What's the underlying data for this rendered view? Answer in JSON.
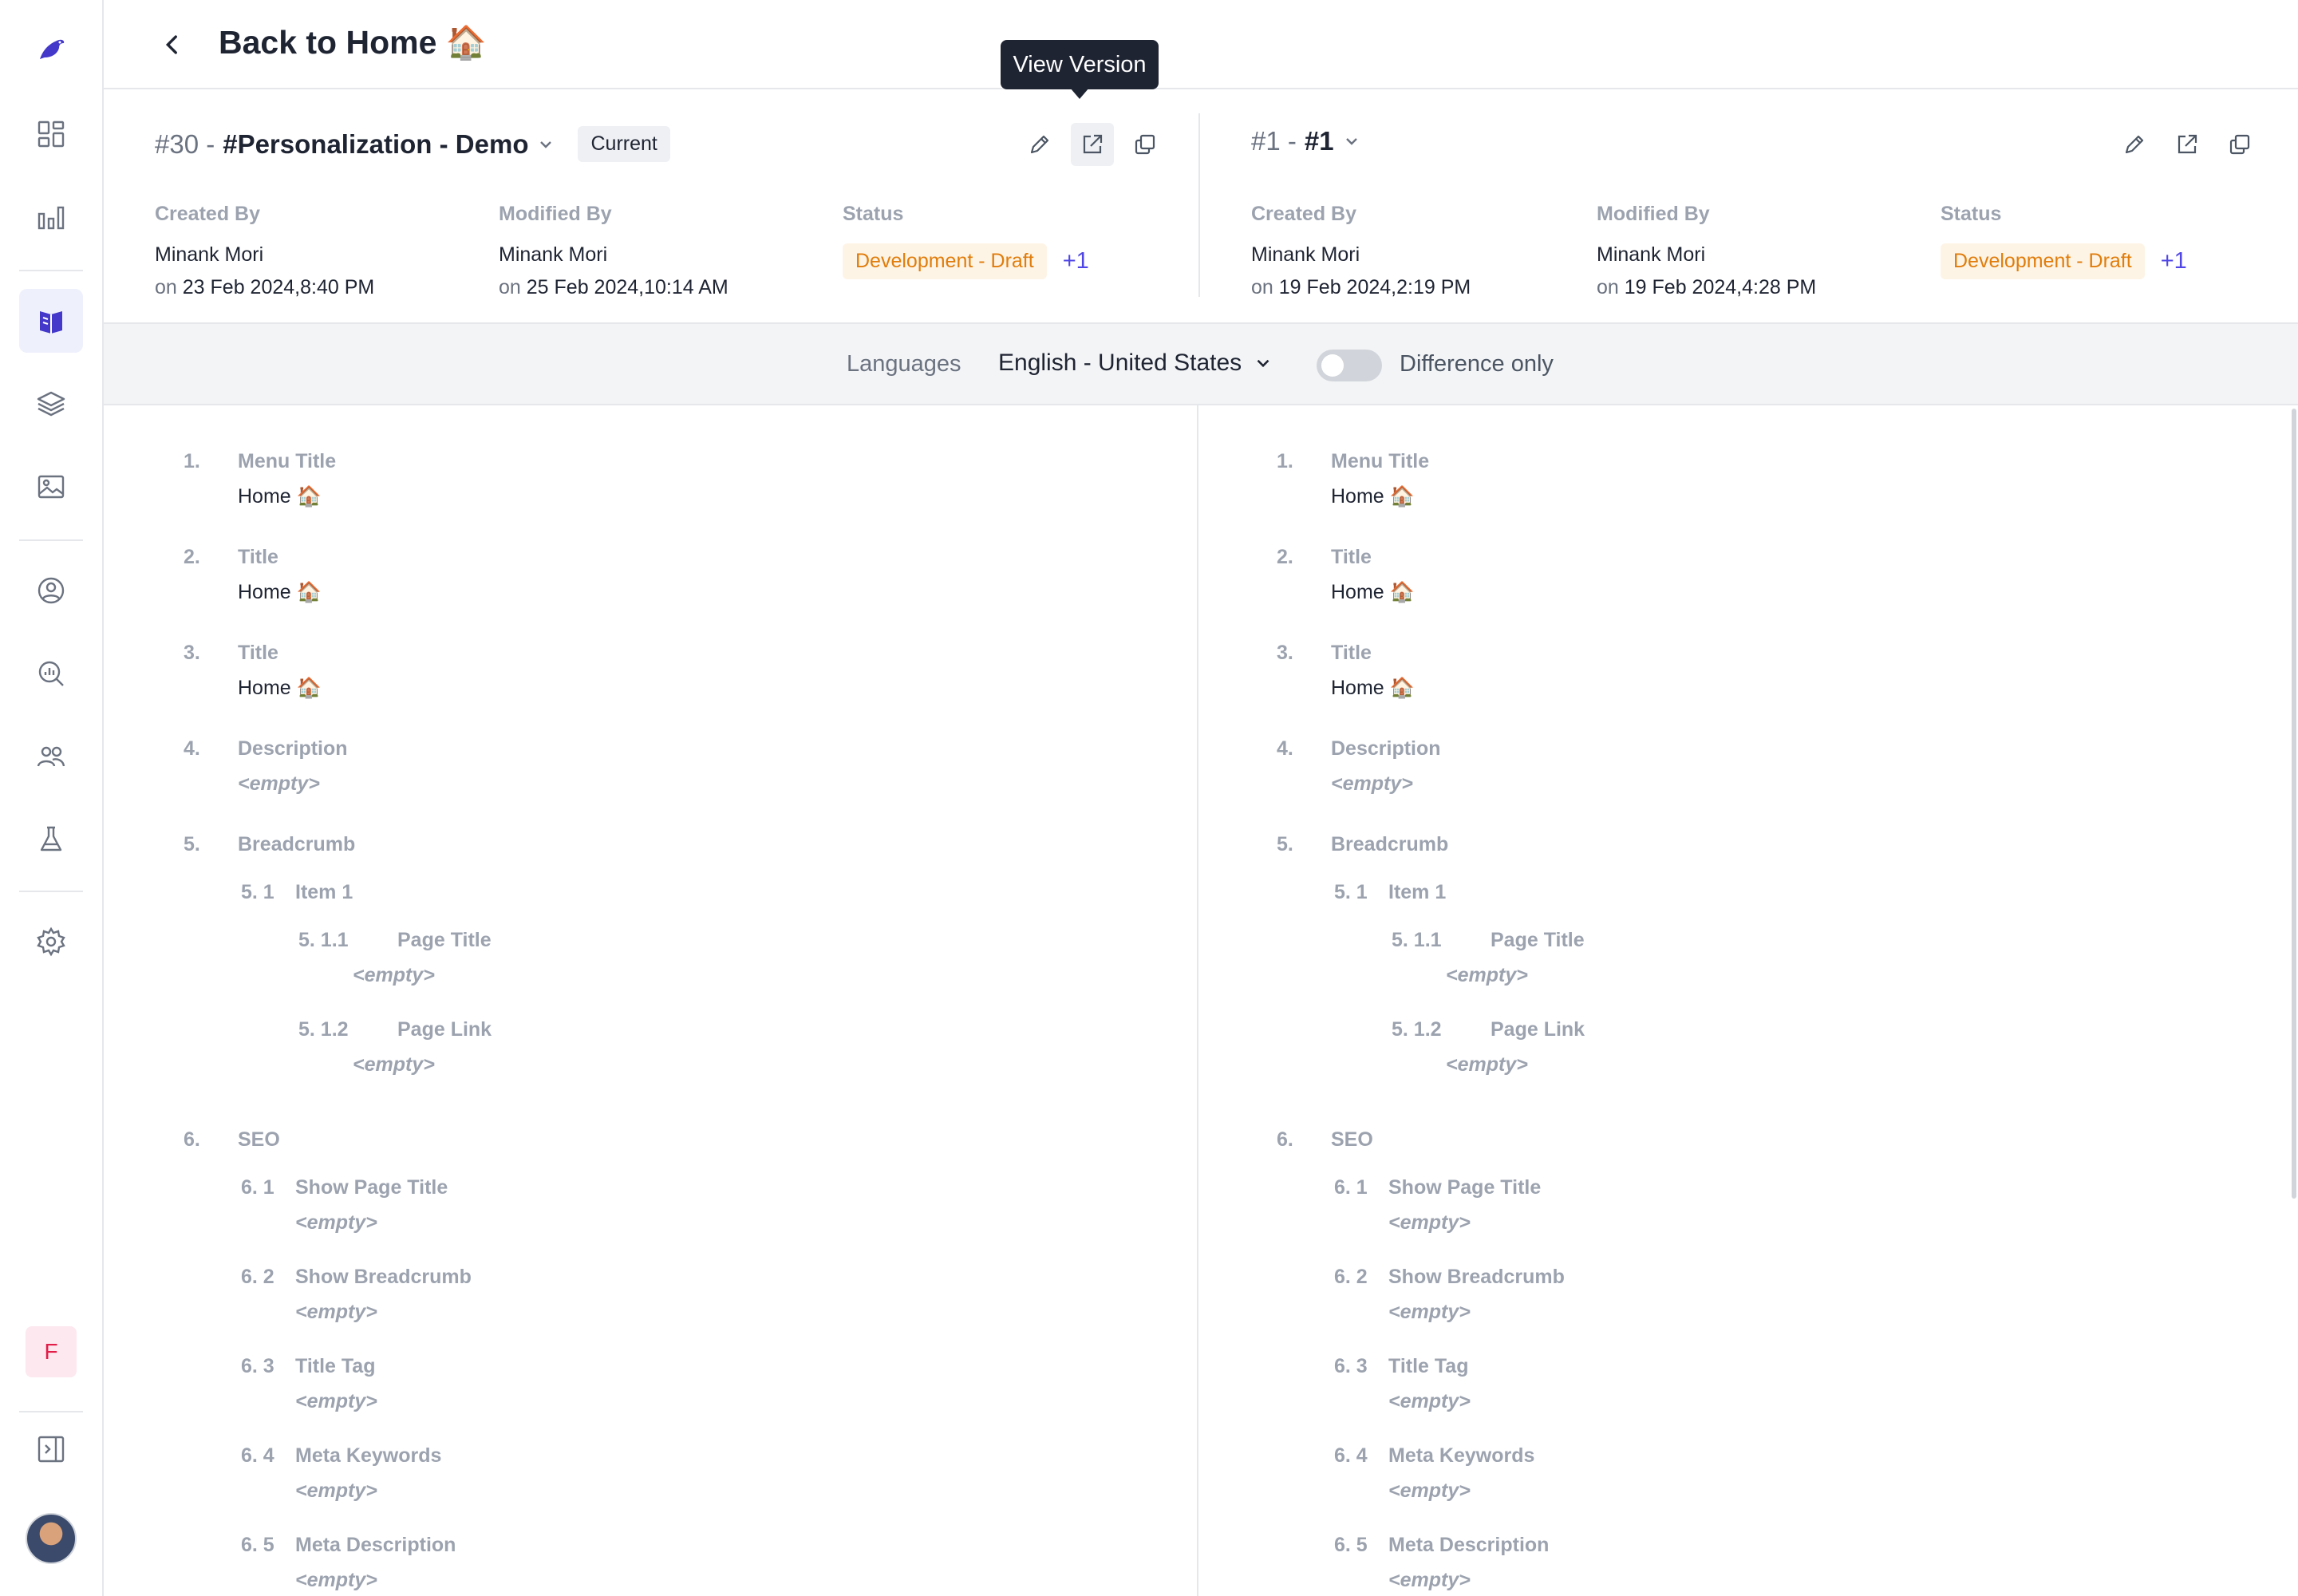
{
  "tooltip": "View Version",
  "header": {
    "back_title": "Back to Home 🏠"
  },
  "left_version": {
    "number": "#30 -",
    "name": "#Personalization - Demo",
    "badge": "Current",
    "created_label": "Created By",
    "created_name": "Minank Mori",
    "created_on_prefix": "on",
    "created_on": "23 Feb 2024,8:40 PM",
    "modified_label": "Modified By",
    "modified_name": "Minank Mori",
    "modified_on_prefix": "on",
    "modified_on": "25 Feb 2024,10:14 AM",
    "status_label": "Status",
    "status": "Development - Draft",
    "status_extra": "+1"
  },
  "right_version": {
    "number": "#1 -",
    "name": "#1",
    "created_label": "Created By",
    "created_name": "Minank Mori",
    "created_on_prefix": "on",
    "created_on": "19 Feb 2024,2:19 PM",
    "modified_label": "Modified By",
    "modified_name": "Minank Mori",
    "modified_on_prefix": "on",
    "modified_on": "19 Feb 2024,4:28 PM",
    "status_label": "Status",
    "status": "Development - Draft",
    "status_extra": "+1"
  },
  "langbar": {
    "label": "Languages",
    "selected": "English - United States",
    "diff_label": "Difference only",
    "diff_on": false
  },
  "fields": [
    {
      "num": "1.",
      "label": "Menu Title",
      "value": "Home 🏠"
    },
    {
      "num": "2.",
      "label": "Title",
      "value": "Home 🏠"
    },
    {
      "num": "3.",
      "label": "Title",
      "value": "Home 🏠"
    },
    {
      "num": "4.",
      "label": "Description",
      "value": "<empty>"
    },
    {
      "num": "5.",
      "label": "Breadcrumb"
    },
    {
      "num": "5. 1",
      "label": "Item 1"
    },
    {
      "num": "5. 1.1",
      "label": "Page Title",
      "value": "<empty>"
    },
    {
      "num": "5. 1.2",
      "label": "Page Link",
      "value": "<empty>"
    },
    {
      "num": "6.",
      "label": "SEO"
    },
    {
      "num": "6. 1",
      "label": "Show Page Title",
      "value": "<empty>"
    },
    {
      "num": "6. 2",
      "label": "Show Breadcrumb",
      "value": "<empty>"
    },
    {
      "num": "6. 3",
      "label": "Title Tag",
      "value": "<empty>"
    },
    {
      "num": "6. 4",
      "label": "Meta Keywords",
      "value": "<empty>"
    },
    {
      "num": "6. 5",
      "label": "Meta Description",
      "value": "<empty>"
    }
  ],
  "sidebar": {
    "icons": [
      "logo-icon",
      "dashboard-icon",
      "analytics-icon",
      "content-icon",
      "layers-icon",
      "media-icon",
      "user-circle-icon",
      "search-insights-icon",
      "users-icon",
      "lab-icon",
      "settings-icon",
      "expand-sidebar-icon"
    ],
    "workspace_initial": "F",
    "active": "content-icon"
  },
  "colors": {
    "accent": "#4f46e5",
    "status_text": "#e07d0c",
    "status_bg": "#fef4e6",
    "tooltip_bg": "#1f2433"
  }
}
